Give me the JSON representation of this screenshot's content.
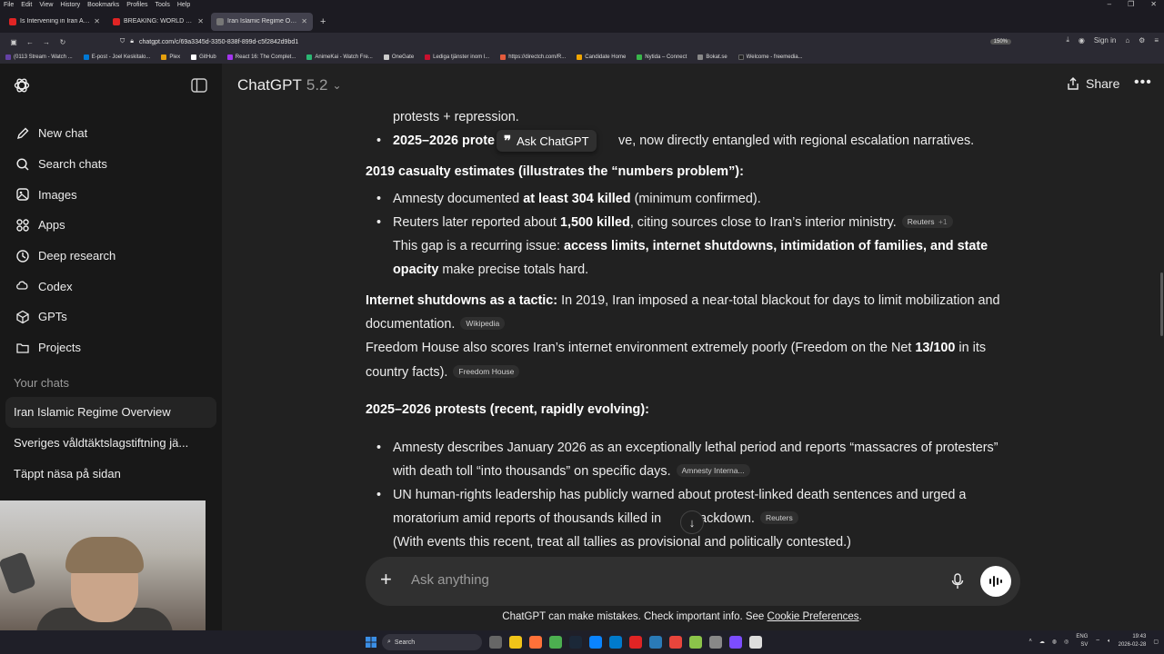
{
  "browser": {
    "menu": [
      "File",
      "Edit",
      "View",
      "History",
      "Bookmarks",
      "Profiles",
      "Tools",
      "Help"
    ],
    "tabs": [
      {
        "title": "Is Intervening in Iran Actually A",
        "color": "#e02424"
      },
      {
        "title": "BREAKING: WORLD ERUPTS AS",
        "color": "#e02424"
      },
      {
        "title": "Iran Islamic Regime Overview",
        "color": "#555555"
      }
    ],
    "url": "chatgpt.com/c/69a3345d-3350-838f-899d-c5f2842d9bd1",
    "zoom": "150%",
    "sign_in": "Sign in",
    "bookmarks": [
      {
        "label": "(0113 Stream - Watch ...",
        "color": "#6441a5"
      },
      {
        "label": "E-post - Joel Keskitalo...",
        "color": "#0078d4"
      },
      {
        "label": "Plex",
        "color": "#e5a00d"
      },
      {
        "label": "GitHub",
        "color": "#ffffff"
      },
      {
        "label": "React 16: The Complet...",
        "color": "#a435f0"
      },
      {
        "label": "AnimeKai - Watch Fre...",
        "color": "#2bb673"
      },
      {
        "label": "OneGate",
        "color": "#cccccc"
      },
      {
        "label": "Lediga tjänster inom l...",
        "color": "#c8102e"
      },
      {
        "label": "https://directch.com/R...",
        "color": "#e55b3c"
      },
      {
        "label": "Candidate Home",
        "color": "#f0a500"
      },
      {
        "label": "Nytida – Connect",
        "color": "#39b54a"
      },
      {
        "label": "Bokat.se",
        "color": "#888888"
      },
      {
        "label": "Welcome - freemedia...",
        "color": "#222222"
      }
    ]
  },
  "sidebar": {
    "nav": [
      {
        "label": "New chat",
        "icon": "edit-icon"
      },
      {
        "label": "Search chats",
        "icon": "search-icon"
      },
      {
        "label": "Images",
        "icon": "image-icon"
      },
      {
        "label": "Apps",
        "icon": "apps-icon"
      },
      {
        "label": "Deep research",
        "icon": "research-icon"
      },
      {
        "label": "Codex",
        "icon": "codex-icon"
      },
      {
        "label": "GPTs",
        "icon": "gpts-icon"
      },
      {
        "label": "Projects",
        "icon": "folder-icon"
      }
    ],
    "section_label": "Your chats",
    "chats": [
      "Iran Islamic Regime Overview",
      "Sveriges våldtäktslagstiftning jä...",
      "Täppt näsa på sidan"
    ]
  },
  "header": {
    "title": "ChatGPT",
    "version": "5.2",
    "share_label": "Share"
  },
  "content": {
    "l1": "protests + repression.",
    "l2_bold": "2025–2026 prote",
    "l2_rest": "ve, now directly entangled with regional escalation narratives.",
    "ask_popup": "Ask ChatGPT",
    "h_2019": "2019 casualty estimates (illustrates the “numbers problem”):",
    "b1_pre": "Amnesty documented ",
    "b1_bold": "at least 304 killed",
    "b1_post": " (minimum confirmed).",
    "b2_pre": "Reuters later reported about ",
    "b2_bold": "1,500 killed",
    "b2_post": ", citing sources close to Iran’s interior ministry.",
    "b2_cite": "Reuters",
    "b2_cite_more": "+1",
    "gap_pre": "This gap is a recurring issue: ",
    "gap_bold1": "access limits, internet shutdowns, intimidation of families, and state",
    "gap_bold2": "opacity",
    "gap_post": " make precise totals hard.",
    "shut_bold": "Internet shutdowns as a tactic:",
    "shut_rest1": " In 2019, Iran imposed a near-total blackout for days to limit mobilization and",
    "shut_rest2": "documentation.",
    "shut_cite": "Wikipedia",
    "fh_pre": "Freedom House also scores Iran’s internet environment extremely poorly (Freedom on the Net ",
    "fh_bold": "13/100",
    "fh_post": " in its",
    "fh_line2": "country facts).",
    "fh_cite": "Freedom House",
    "h_2025": "2025–2026 protests (recent, rapidly evolving):",
    "c1_l1": "Amnesty describes January 2026 as an exceptionally lethal period and reports “massacres of protesters”",
    "c1_l2": "with death toll “into thousands” on specific days.",
    "c1_cite": "Amnesty Interna...",
    "c2_l1": "UN human-rights leadership has publicly warned about protest-linked death sentences and urged a",
    "c2_l2a": "moratorium amid reports of thousands killed in ",
    "c2_l2b": "crackdown.",
    "c2_cite": "Reuters",
    "note": "(With events this recent, treat all tallies as provisional and politically contested.)"
  },
  "composer": {
    "placeholder": "Ask anything"
  },
  "disclaimer": {
    "text": "ChatGPT can make mistakes. Check important info. See ",
    "link": "Cookie Preferences",
    "end": "."
  },
  "taskbar": {
    "search_label": "Search",
    "lang1": "ENG",
    "lang2": "SV",
    "time": "19:43",
    "date": "2026-02-28"
  }
}
